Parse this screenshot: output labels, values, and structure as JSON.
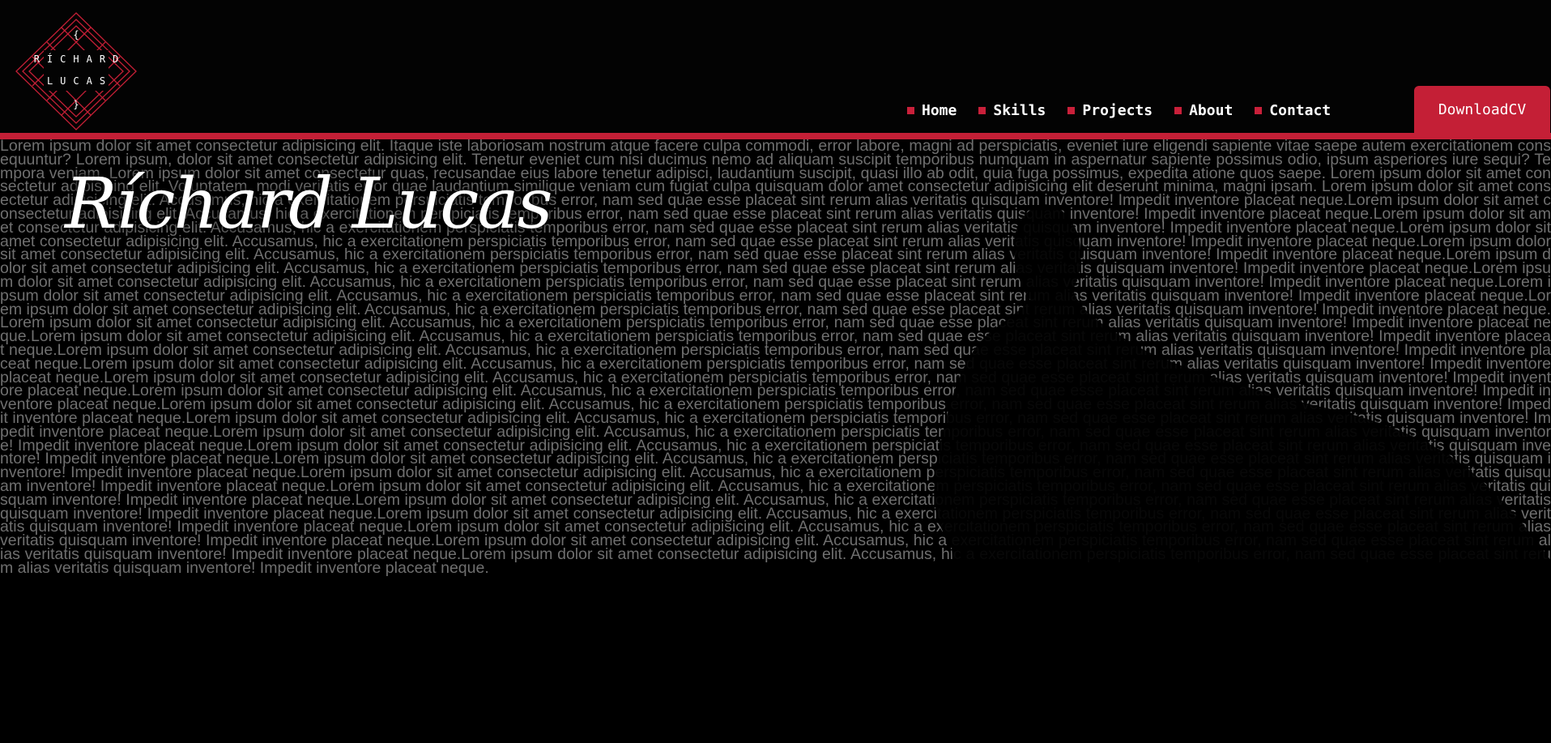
{
  "logo": {
    "brace_open": "{",
    "name_line1": "RÍCHARD",
    "name_line2": "LUCAS",
    "brace_close": "}"
  },
  "nav": {
    "items": [
      {
        "label": "Home"
      },
      {
        "label": "Skills"
      },
      {
        "label": "Projects"
      },
      {
        "label": "About"
      },
      {
        "label": "Contact"
      }
    ],
    "download_label": "DownloadCV"
  },
  "hero": {
    "title": "Ríchard Lucas",
    "background_text": "Lorem ipsum dolor sit amet consectetur adipisicing elit. Itaque iste laboriosam nostrum atque facere culpa commodi, error labore, magni ad perspiciatis, eveniet iure eligendi sapiente vitae saepe autem exercitationem consequuntur? Lorem ipsum, dolor sit amet consectetur adipisicing elit. Tenetur eveniet cum nisi ducimus nemo ad aliquam suscipit temporibus numquam in aspernatur sapiente possimus odio, ipsum asperiores iure sequi? Tempora veniam. Lorem ipsum dolor sit amet consectetur quas, recusandae eius labore tenetur adipisci, laudantium suscipit, quasi illo ab odit, quia fuga possimus, expedita atione quos saepe. Lorem ipsum dolor sit amet consectetur adipisicing elit. Voluptatem, modi veritatis error quae laudantium similique veniam cum fugiat culpa quisquam dolor amet consectetur adipisicing elit deserunt minima, magni ipsam. Lorem ipsum dolor sit amet consectetur adipisicing elit. Accusamus, hic a exercitationem perspiciatis temporibus error, nam sed quae esse placeat sint rerum alias veritatis quisquam inventore! Impedit inventore placeat neque.Lorem ipsum dolor sit amet consectetur adipisicing elit. Accusamus, hic a exercitationem perspiciatis temporibus error, nam sed quae esse placeat sint rerum alias veritatis quisquam inventore! Impedit inventore placeat neque.Lorem ipsum dolor sit amet consectetur adipisicing elit. Accusamus, hic a exercitationem perspiciatis temporibus error, nam sed quae esse placeat sint rerum alias veritatis quisquam inventore! Impedit inventore placeat neque.Lorem ipsum dolor sit amet consectetur adipisicing elit. Accusamus, hic a exercitationem perspiciatis temporibus error, nam sed quae esse placeat sint rerum alias veritatis quisquam inventore! Impedit inventore placeat neque.Lorem ipsum dolor sit amet consectetur adipisicing elit. Accusamus, hic a exercitationem perspiciatis temporibus error, nam sed quae esse placeat sint rerum alias veritatis quisquam inventore! Impedit inventore placeat neque.Lorem ipsum dolor sit amet consectetur adipisicing elit. Accusamus, hic a exercitationem perspiciatis temporibus error, nam sed quae esse placeat sint rerum alias veritatis quisquam inventore! Impedit inventore placeat neque.Lorem ipsum dolor sit amet consectetur adipisicing elit. Accusamus, hic a exercitationem perspiciatis temporibus error, nam sed quae esse placeat sint rerum alias veritatis quisquam inventore! Impedit inventore placeat neque.Lorem ipsum dolor sit amet consectetur adipisicing elit. Accusamus, hic a exercitationem perspiciatis temporibus error, nam sed quae esse placeat sint rerum alias veritatis quisquam inventore! Impedit inventore placeat neque.Lorem ipsum dolor sit amet consectetur adipisicing elit. Accusamus, hic a exercitationem perspiciatis temporibus error, nam sed quae esse placeat sint rerum alias veritatis quisquam inventore! Impedit inventore placeat neque.Lorem ipsum dolor sit amet consectetur adipisicing elit. Accusamus, hic a exercitationem perspiciatis temporibus error, nam sed quae esse placeat sint rerum alias veritatis quisquam inventore! Impedit inventore placeat neque.Lorem ipsum dolor sit amet consectetur adipisicing elit. Accusamus, hic a exercitationem perspiciatis temporibus error, nam sed quae esse placeat sint rerum alias veritatis quisquam inventore! Impedit inventore placeat neque.Lorem ipsum dolor sit amet consectetur adipisicing elit. Accusamus, hic a exercitationem perspiciatis temporibus error, nam sed quae esse placeat sint rerum alias veritatis quisquam inventore! Impedit inventore placeat neque.Lorem ipsum dolor sit amet consectetur adipisicing elit. Accusamus, hic a exercitationem perspiciatis temporibus error, nam sed quae esse placeat sint rerum alias veritatis quisquam inventore! Impedit inventore placeat neque.Lorem ipsum dolor sit amet consectetur adipisicing elit. Accusamus, hic a exercitationem perspiciatis temporibus error, nam sed quae esse placeat sint rerum alias veritatis quisquam inventore! Impedit inventore placeat neque.Lorem ipsum dolor sit amet consectetur adipisicing elit. Accusamus, hic a exercitationem perspiciatis temporibus error, nam sed quae esse placeat sint rerum alias veritatis quisquam inventore! Impedit inventore placeat neque.Lorem ipsum dolor sit amet consectetur adipisicing elit. Accusamus, hic a exercitationem perspiciatis temporibus error, nam sed quae esse placeat sint rerum alias veritatis quisquam inventore! Impedit inventore placeat neque.Lorem ipsum dolor sit amet consectetur adipisicing elit. Accusamus, hic a exercitationem perspiciatis temporibus error, nam sed quae esse placeat sint rerum alias veritatis quisquam inventore! Impedit inventore placeat neque.Lorem ipsum dolor sit amet consectetur adipisicing elit. Accusamus, hic a exercitationem perspiciatis temporibus error, nam sed quae esse placeat sint rerum alias veritatis quisquam inventore! Impedit inventore placeat neque.Lorem ipsum dolor sit amet consectetur adipisicing elit. Accusamus, hic a exercitationem perspiciatis temporibus error, nam sed quae esse placeat sint rerum alias veritatis quisquam inventore! Impedit inventore placeat neque.Lorem ipsum dolor sit amet consectetur adipisicing elit. Accusamus, hic a exercitationem perspiciatis temporibus error, nam sed quae esse placeat sint rerum alias veritatis quisquam inventore! Impedit inventore placeat neque.Lorem ipsum dolor sit amet consectetur adipisicing elit. Accusamus, hic a exercitationem perspiciatis temporibus error, nam sed quae esse placeat sint rerum alias veritatis quisquam inventore! Impedit inventore placeat neque.Lorem ipsum dolor sit amet consectetur adipisicing elit. Accusamus, hic a exercitationem perspiciatis temporibus error, nam sed quae esse placeat sint rerum alias veritatis quisquam inventore! Impedit inventore placeat neque.Lorem ipsum dolor sit amet consectetur adipisicing elit. Accusamus, hic a exercitationem perspiciatis temporibus error, nam sed quae esse placeat sint rerum alias veritatis quisquam inventore! Impedit inventore placeat neque.Lorem ipsum dolor sit amet consectetur adipisicing elit. Accusamus, hic a exercitationem perspiciatis temporibus error, nam sed quae esse placeat sint rerum alias veritatis quisquam inventore! Impedit inventore placeat neque.Lorem ipsum dolor sit amet consectetur adipisicing elit. Accusamus, hic a exercitationem perspiciatis temporibus error, nam sed quae esse placeat sint rerum alias veritatis quisquam inventore! Impedit inventore placeat neque.Lorem ipsum dolor sit amet consectetur adipisicing elit. Accusamus, hic a exercitationem perspiciatis temporibus error, nam sed quae esse placeat sint rerum alias veritatis quisquam inventore! Impedit inventore placeat neque.Lorem ipsum dolor sit amet consectetur adipisicing elit. Accusamus, hic a exercitationem perspiciatis temporibus error, nam sed quae esse placeat sint rerum alias veritatis quisquam inventore! Impedit inventore placeat neque."
  },
  "colors": {
    "accent": "#c41f36",
    "background": "#020202",
    "text": "#ffffff",
    "muted_text": "#6f6f6f"
  },
  "icons": {
    "logo": "diamond-lattice-logo-icon",
    "nav_bullet": "red-square-bullet-icon"
  }
}
